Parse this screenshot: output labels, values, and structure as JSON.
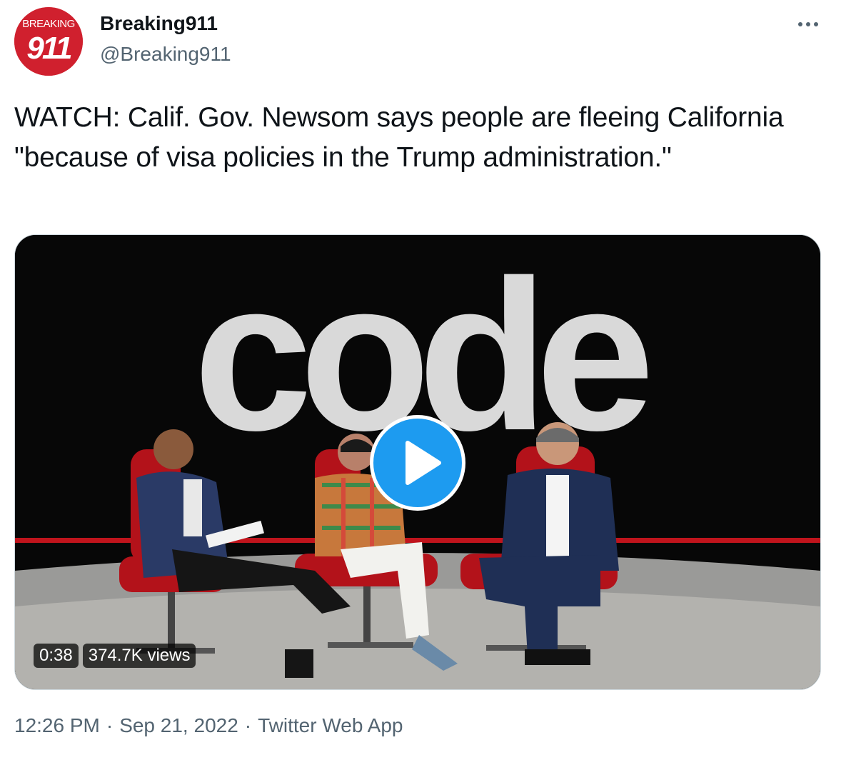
{
  "author": {
    "name": "Breaking911",
    "handle": "@Breaking911",
    "avatar": {
      "top_text": "BREAKING",
      "number": "911",
      "bg_color": "#d0202e",
      "text_color": "#ffffff"
    }
  },
  "more_icon": "more-horizontal-icon",
  "tweet": {
    "text": "WATCH: Calif. Gov. Newsom says people are fleeing California \"because of visa policies in the Trump administration.\""
  },
  "media": {
    "type": "video",
    "stage_sign": "code",
    "duration": "0:38",
    "views": "374.7K views",
    "play_icon": "play-icon",
    "play_color": "#1d9bf0",
    "stage_stripe_color": "#c0141c"
  },
  "footer": {
    "time": "12:26 PM",
    "separator": "·",
    "date": "Sep 21, 2022",
    "source": "Twitter Web App"
  },
  "colors": {
    "text_primary": "#0f1419",
    "text_secondary": "#536471",
    "border": "#cfd9de"
  }
}
